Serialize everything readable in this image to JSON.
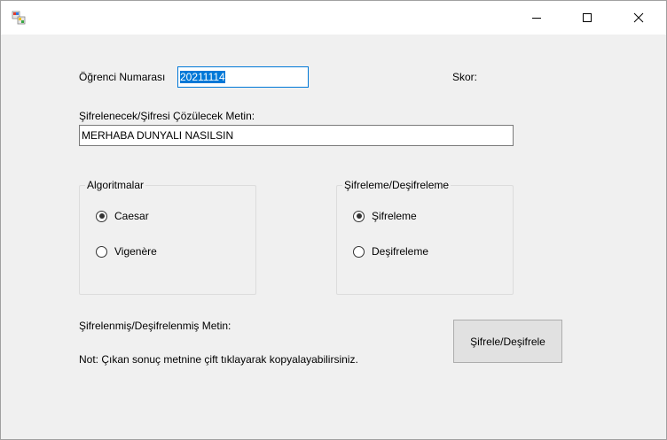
{
  "titlebar": {
    "title": ""
  },
  "form": {
    "student_label": "Öğrenci Numarası",
    "student_value": "20211114",
    "score_label": "Skor:",
    "text_label": "Şifrelenecek/Şifresi Çözülecek Metin:",
    "text_value": "MERHABA DUNYALI NASILSIN",
    "algorithms": {
      "title": "Algoritmalar",
      "options": [
        {
          "label": "Caesar",
          "checked": true
        },
        {
          "label": "Vigenère",
          "checked": false
        }
      ]
    },
    "mode": {
      "title": "Şifreleme/Deşifreleme",
      "options": [
        {
          "label": "Şifreleme",
          "checked": true
        },
        {
          "label": "Deşifreleme",
          "checked": false
        }
      ]
    },
    "result_label": "Şifrelenmiş/Deşifrelenmiş Metin:",
    "note": "Not: Çıkan sonuç metnine çift tıklayarak kopyalayabilirsiniz.",
    "submit_label": "Şifrele/Deşifrele"
  }
}
